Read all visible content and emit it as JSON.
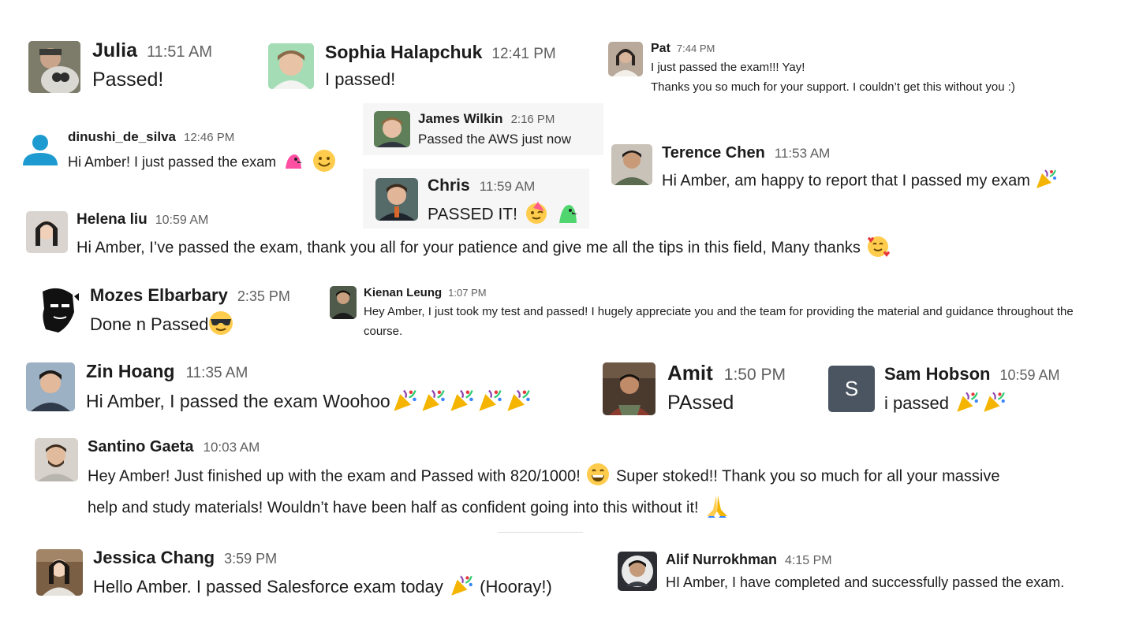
{
  "colors": {
    "name_text": "#1d1c1d",
    "timestamp_text": "#616061",
    "highlight_bg": "#f6f6f6",
    "sam_avatar_bg": "#4a5561",
    "default_avatar_blue": "#1d9bd1"
  },
  "messages": [
    {
      "id": "julia",
      "name": "Julia",
      "time": "11:51 AM",
      "text": "Passed!",
      "avatar_icon": "user-photo-with-dog"
    },
    {
      "id": "sophia",
      "name": "Sophia Halapchuk",
      "time": "12:41 PM",
      "text": "I passed!",
      "avatar_icon": "user-photo"
    },
    {
      "id": "pat",
      "name": "Pat",
      "time": "7:44 PM",
      "lines": [
        "I just passed the exam!!! Yay!",
        "Thanks you so much for your support. I couldn’t get this without you :)"
      ],
      "avatar_icon": "user-photo"
    },
    {
      "id": "james",
      "name": "James Wilkin",
      "time": "2:16 PM",
      "text": "Passed the AWS just now",
      "avatar_icon": "user-photo"
    },
    {
      "id": "dinushi",
      "name": "dinushi_de_silva",
      "time": "12:46 PM",
      "text": "Hi Amber! I just passed the exam",
      "emojis": [
        "parrot-emoji",
        "smile-emoji"
      ],
      "avatar_icon": "default-user-icon"
    },
    {
      "id": "terence",
      "name": "Terence Chen",
      "time": "11:53 AM",
      "text": "Hi Amber, am happy to report that I passed my exam",
      "emojis": [
        "party-popper-emoji"
      ],
      "avatar_icon": "user-photo"
    },
    {
      "id": "chris",
      "name": "Chris",
      "time": "11:59 AM",
      "text": "PASSED IT!",
      "emojis": [
        "partying-face-emoji",
        "parrot-emoji"
      ],
      "avatar_icon": "user-photo"
    },
    {
      "id": "helena",
      "name": "Helena liu",
      "time": "10:59 AM",
      "text": "Hi Amber, I’ve passed the exam, thank you all for your patience and give me all the tips in this field, Many thanks",
      "emojis": [
        "smiling-face-with-hearts-emoji"
      ],
      "avatar_icon": "user-photo"
    },
    {
      "id": "mozes",
      "name": "Mozes Elbarbary",
      "time": "2:35 PM",
      "text": "Done n Passed",
      "emojis": [
        "sunglasses-emoji"
      ],
      "avatar_icon": "bw-portrait"
    },
    {
      "id": "kienan",
      "name": "Kienan Leung",
      "time": "1:07 PM",
      "text": "Hey Amber, I just took my test and passed! I hugely appreciate you and the team for providing the material and guidance throughout the course.",
      "avatar_icon": "user-photo"
    },
    {
      "id": "zin",
      "name": "Zin Hoang",
      "time": "11:35 AM",
      "text": "Hi Amber, I passed the exam Woohoo",
      "emojis": [
        "party-popper-emoji",
        "party-popper-emoji",
        "party-popper-emoji",
        "party-popper-emoji",
        "party-popper-emoji"
      ],
      "avatar_icon": "user-photo"
    },
    {
      "id": "amit",
      "name": "Amit",
      "time": "1:50 PM",
      "text": "PAssed",
      "avatar_icon": "user-photo"
    },
    {
      "id": "sam",
      "name": "Sam Hobson",
      "time": "10:59 AM",
      "text": "i passed",
      "emojis": [
        "party-popper-emoji",
        "party-popper-emoji"
      ],
      "avatar_letter": "S",
      "avatar_icon": "letter-avatar"
    },
    {
      "id": "santino",
      "name": "Santino Gaeta",
      "time": "10:03 AM",
      "text_a": "Hey Amber! Just finished up with the exam and Passed with 820/1000!",
      "text_b": "Super stoked!! Thank you so much for all your massive",
      "text_c": "help and study materials! Wouldn’t have been half as confident going into this without it!",
      "emojis": [
        "grin-emoji",
        "folded-hands-emoji"
      ],
      "avatar_icon": "user-photo"
    },
    {
      "id": "jessica",
      "name": "Jessica Chang",
      "time": "3:59 PM",
      "text_a": "Hello Amber. I passed Salesforce exam today",
      "text_b": "(Hooray!)",
      "emojis": [
        "party-popper-emoji"
      ],
      "avatar_icon": "user-photo"
    },
    {
      "id": "alif",
      "name": "Alif Nurrokhman",
      "time": "4:15 PM",
      "text": "HI Amber, I have completed and successfully passed the exam.",
      "avatar_icon": "user-photo"
    }
  ]
}
